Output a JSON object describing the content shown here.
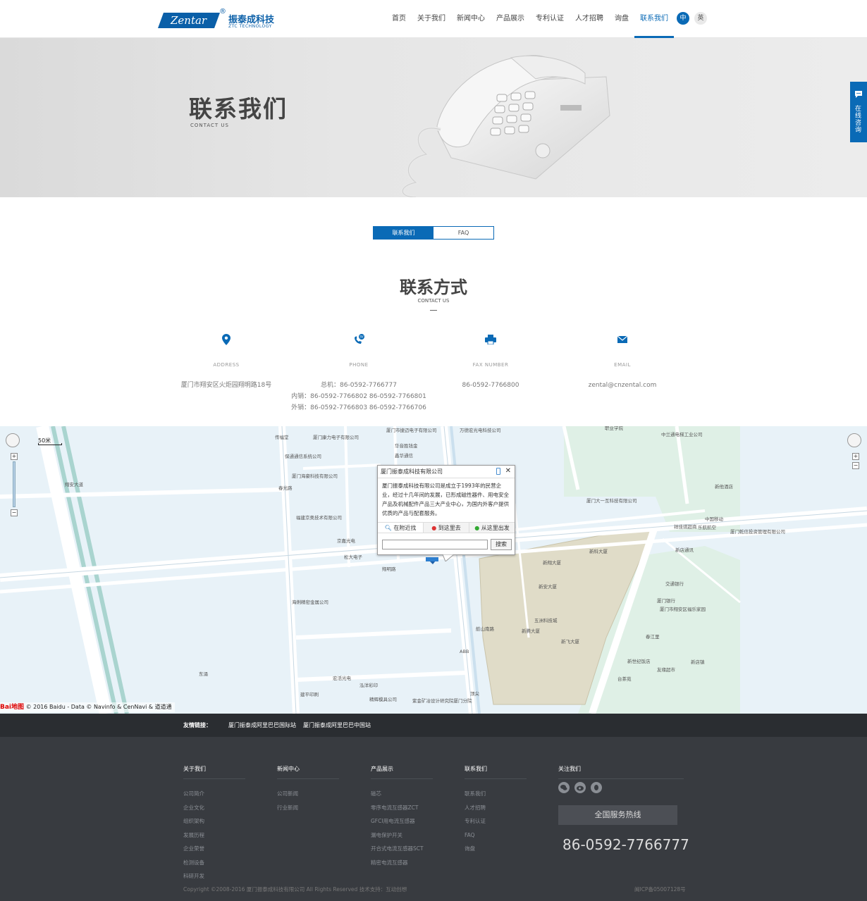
{
  "header": {
    "logo_en": "Zentar",
    "logo_reg": "®",
    "logo_cn": "振泰成科技",
    "logo_sub": "ZTC TECHNOLOGY",
    "nav": [
      "首页",
      "关于我们",
      "新闻中心",
      "产品展示",
      "专利认证",
      "人才招聘",
      "询盘",
      "联系我们"
    ],
    "active_nav": "联系我们",
    "lang_zh": "中",
    "lang_en": "英"
  },
  "banner": {
    "title": "联系我们",
    "subtitle": "CONTACT  US"
  },
  "side_consult": "在线咨询",
  "tabs": [
    "联系我们",
    "FAQ"
  ],
  "section": {
    "title": "联系方式",
    "subtitle": "CONTACT US"
  },
  "contacts": [
    {
      "icon": "location-pin-icon",
      "label": "ADDRESS",
      "lines": [
        "厦门市翔安区火炬园翔明路18号"
      ]
    },
    {
      "icon": "phone-icon",
      "label": "PHONE",
      "lines": [
        "总机：86-0592-7766777",
        "内销：86-0592-7766802 86-0592-7766801",
        "外销：86-0592-7766803 86-0592-7766706"
      ]
    },
    {
      "icon": "fax-icon",
      "label": "FAX NUMBER",
      "lines": [
        "86-0592-7766800"
      ]
    },
    {
      "icon": "email-icon",
      "label": "EMAIL",
      "lines": [
        "zental@cnzental.com"
      ]
    }
  ],
  "map": {
    "scale": "50米",
    "popup_title": "厦门振泰成科技有限公司",
    "popup_body": "厦门振泰成科技有限公司是成立于1993年的民营企业，经过十几年间的发展，已形成磁性器件、用电安全产品及机械配件产品三大产业中心，为国内外客户提供优质的产品与配套服务。",
    "popup_tabs": [
      "在附近找",
      "到这里去",
      "从这里出发"
    ],
    "popup_search": "搜索",
    "copyright": "© 2016 Baidu - Data © Navinfo & CenNavi & 道道通",
    "baidu": "Bai地图",
    "labels": [
      {
        "t": "传福堂"
      },
      {
        "t": "厦门康力电子有限公司"
      },
      {
        "t": "厦门市捷迈电子有限公司"
      },
      {
        "t": "万德宏光电科技公司"
      },
      {
        "t": "华音胜钱金"
      },
      {
        "t": "鑫华通信"
      },
      {
        "t": "保通通信系统公司"
      },
      {
        "t": "厦门海豪科技有限公司"
      },
      {
        "t": "福建京奥技术有限公司"
      },
      {
        "t": "京嘉光电"
      },
      {
        "t": "松大电子"
      },
      {
        "t": "翔明路"
      },
      {
        "t": "春光路"
      },
      {
        "t": "翔安大道"
      },
      {
        "t": "新科大厦"
      },
      {
        "t": "新翔大厦"
      },
      {
        "t": "新安大厦"
      },
      {
        "t": "五洲科技城"
      },
      {
        "t": "新腾大厦"
      },
      {
        "t": "新飞大厦"
      },
      {
        "t": "厦门市翔安区福乐家园"
      },
      {
        "t": "中国移动"
      },
      {
        "t": "乐航航空"
      },
      {
        "t": "交通银行"
      },
      {
        "t": "厦门银行"
      },
      {
        "t": "春江里"
      },
      {
        "t": "新世纪饭店"
      },
      {
        "t": "台茶苑"
      },
      {
        "t": "友缘超市"
      },
      {
        "t": "海俐精密金属公司"
      },
      {
        "t": "宏活光电"
      },
      {
        "t": "建平印刷"
      },
      {
        "t": "泓洋彩印"
      },
      {
        "t": "精辉模具公司"
      },
      {
        "t": "紫金矿冶设计研究院厦门分院"
      },
      {
        "t": "厦门大一互科技有限公司"
      },
      {
        "t": "新店通讯"
      },
      {
        "t": "祥佳琪超商"
      },
      {
        "t": "厦门乾信投资管理有限公司"
      },
      {
        "t": "东涌"
      },
      {
        "t": "ABB"
      },
      {
        "t": "舫山南路"
      },
      {
        "t": "职业学院"
      },
      {
        "t": "中兰通电梯工业公司"
      },
      {
        "t": "新他酒店"
      },
      {
        "t": "顶尖"
      },
      {
        "t": "新店镇"
      }
    ]
  },
  "links_bar": {
    "label": "友情链接：",
    "links": [
      "厦门振泰成阿里巴巴国际站",
      "厦门振泰成阿里巴巴中国站"
    ]
  },
  "footer": {
    "cols": [
      {
        "head": "关于我们",
        "items": [
          "公司简介",
          "企业文化",
          "组织架构",
          "发展历程",
          "企业荣誉",
          "检测设备",
          "科研开发"
        ]
      },
      {
        "head": "新闻中心",
        "items": [
          "公司新闻",
          "行业新闻"
        ]
      },
      {
        "head": "产品展示",
        "items": [
          "磁芯",
          "零序电流互感器ZCT",
          "GFCI用电流互感器",
          "漏电保护开关",
          "开合式电流互感器SCT",
          "精密电流互感器"
        ]
      },
      {
        "head": "联系我们",
        "items": [
          "联系我们",
          "人才招聘",
          "专利认证",
          "FAQ",
          "询盘"
        ]
      }
    ],
    "follow_head": "关注我们",
    "social_icons": [
      "wechat-icon",
      "weibo-icon",
      "qq-icon"
    ],
    "hotline_label": "全国服务热线",
    "hotline": "86-0592-7766777",
    "copyright": "Copyright ©2008-2016 厦门振泰成科技有限公司 All Rights Reserved  技术支持：互动创想",
    "icp": "闽ICP备05007128号"
  },
  "colors": {
    "brand": "#0a6ab6",
    "footer_bg": "#383b40",
    "links_bg": "#2a2d31"
  }
}
